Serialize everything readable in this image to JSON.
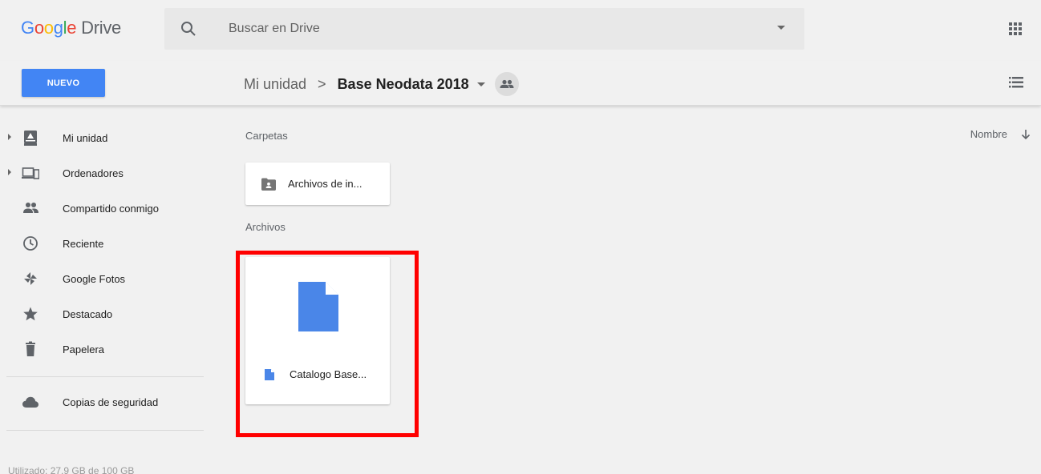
{
  "header": {
    "logo_google": [
      "G",
      "o",
      "o",
      "g",
      "l",
      "e"
    ],
    "logo_product": "Drive",
    "search_placeholder": "Buscar en Drive"
  },
  "toolbar": {
    "new_label": "NUEVO",
    "breadcrumb_root": "Mi unidad",
    "breadcrumb_separator": ">",
    "breadcrumb_current": "Base Neodata 2018"
  },
  "sidebar": {
    "items": [
      {
        "label": "Mi unidad",
        "icon": "my-drive-icon",
        "expandable": true
      },
      {
        "label": "Ordenadores",
        "icon": "computers-icon",
        "expandable": true
      },
      {
        "label": "Compartido conmigo",
        "icon": "shared-people-icon",
        "expandable": false
      },
      {
        "label": "Reciente",
        "icon": "clock-icon",
        "expandable": false
      },
      {
        "label": "Google Fotos",
        "icon": "pinwheel-icon",
        "expandable": false
      },
      {
        "label": "Destacado",
        "icon": "star-icon",
        "expandable": false
      },
      {
        "label": "Papelera",
        "icon": "trash-icon",
        "expandable": false
      }
    ],
    "backup_label": "Copias de seguridad",
    "storage_text": "Utilizado: 27,9 GB de 100 GB"
  },
  "main": {
    "folders_label": "Carpetas",
    "files_label": "Archivos",
    "sort_label": "Nombre",
    "folders": [
      {
        "name": "Archivos de in..."
      }
    ],
    "files": [
      {
        "name": "Catalogo Base..."
      }
    ]
  },
  "colors": {
    "accent": "#4285f4",
    "highlight": "#ff0000",
    "background": "#f1f1f1"
  }
}
